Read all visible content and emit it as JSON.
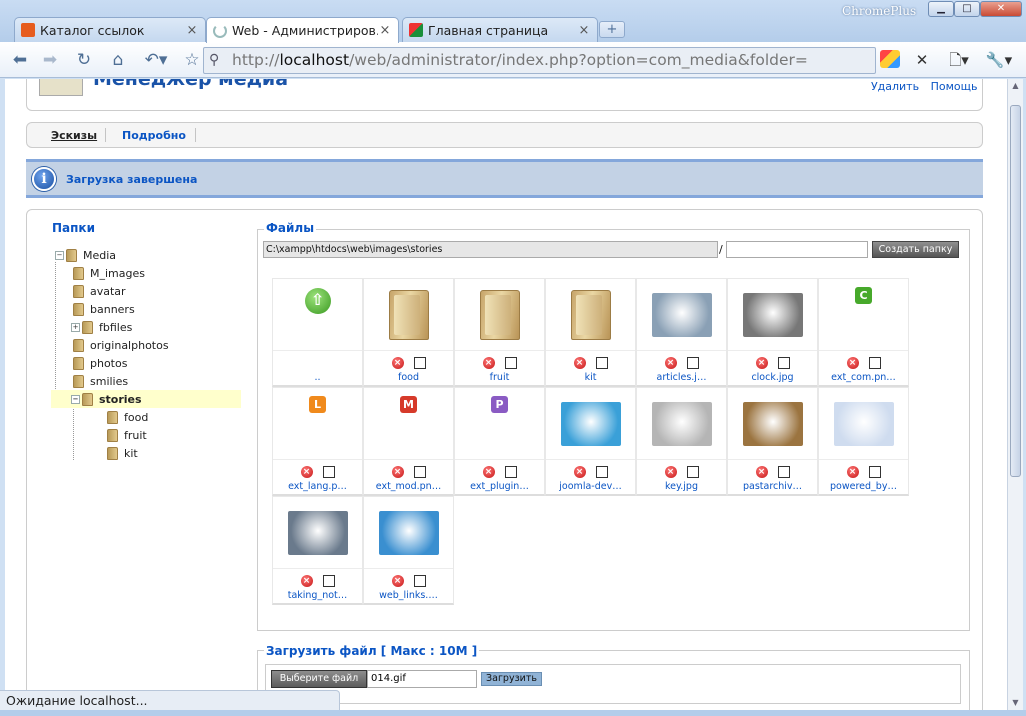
{
  "browser": {
    "brand": "ChromePlus",
    "tabs": [
      {
        "title": "Каталог ссылок",
        "fav_color": "#e65c1e"
      },
      {
        "title": "Web - Администриров…",
        "fav_color": "#ffffff"
      },
      {
        "title": "Главная страница",
        "fav_color": "#1a8f3a"
      }
    ],
    "url_prefix": "http://",
    "url_host": "localhost",
    "url_path": "/web/administrator/index.php?option=com_media&folder=",
    "status": "Ожидание localhost..."
  },
  "header": {
    "title": "Менеджер медиа",
    "delete_label": "Удалить",
    "help_label": "Помощь"
  },
  "submenu": {
    "thumbs": "Эскизы",
    "details": "Подробно"
  },
  "message": "Загрузка завершена",
  "folders": {
    "title": "Папки",
    "tree": [
      "Media",
      "M_images",
      "avatar",
      "banners",
      "fbfiles",
      "originalphotos",
      "photos",
      "smilies",
      "stories",
      "food",
      "fruit",
      "kit"
    ]
  },
  "files": {
    "legend": "Файлы",
    "path": "C:\\xampp\\htdocs\\web\\images\\stories",
    "slash": "/",
    "create_folder": "Создать папку",
    "items": [
      {
        "name": "..",
        "kind": "up"
      },
      {
        "name": "food",
        "kind": "folder"
      },
      {
        "name": "fruit",
        "kind": "folder"
      },
      {
        "name": "kit",
        "kind": "folder"
      },
      {
        "name": "articles.j…",
        "kind": "image",
        "color": "#8aa0b5"
      },
      {
        "name": "clock.jpg",
        "kind": "image",
        "color": "#777777"
      },
      {
        "name": "ext_com.pn…",
        "kind": "badge",
        "letter": "C",
        "color": "#47a92b"
      },
      {
        "name": "ext_lang.p…",
        "kind": "badge",
        "letter": "L",
        "color": "#f08a1c"
      },
      {
        "name": "ext_mod.pn…",
        "kind": "badge",
        "letter": "M",
        "color": "#d63a2a"
      },
      {
        "name": "ext_plugin…",
        "kind": "badge",
        "letter": "P",
        "color": "#8a5bc3"
      },
      {
        "name": "joomla-dev…",
        "kind": "image",
        "color": "#3aa0d8"
      },
      {
        "name": "key.jpg",
        "kind": "image",
        "color": "#b5b5b5"
      },
      {
        "name": "pastarchiv…",
        "kind": "image",
        "color": "#9b7440"
      },
      {
        "name": "powered_by…",
        "kind": "image",
        "color": "#cfdcef"
      },
      {
        "name": "taking_not…",
        "kind": "image",
        "color": "#6a7a8c"
      },
      {
        "name": "web_links.…",
        "kind": "image",
        "color": "#3a8fd0"
      }
    ]
  },
  "upload": {
    "legend": "Загрузить файл [ Макс : 10M ]",
    "choose": "Выберите файл",
    "filename": "014.gif",
    "submit": "Загрузить"
  }
}
